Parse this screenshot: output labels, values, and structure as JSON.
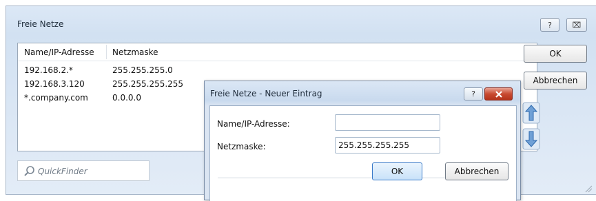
{
  "main_window": {
    "title": "Freie Netze",
    "help_glyph": "?",
    "close_glyph": "⌧"
  },
  "list": {
    "columns": [
      "Name/IP-Adresse",
      "Netzmaske"
    ],
    "rows": [
      {
        "name": "192.168.2.*",
        "mask": "255.255.255.0"
      },
      {
        "name": "192.168.3.120",
        "mask": "255.255.255.255"
      },
      {
        "name": "*.company.com",
        "mask": "0.0.0.0"
      }
    ]
  },
  "quickfinder": {
    "placeholder": "QuickFinder",
    "icon": "search-icon"
  },
  "buttons": {
    "ok": "OK",
    "cancel": "Abbrechen",
    "up_icon": "arrow-up-icon",
    "down_icon": "arrow-down-icon"
  },
  "sub_dialog": {
    "title": "Freie Netze - Neuer Eintrag",
    "help_glyph": "?",
    "name_label": "Name/IP-Adresse:",
    "name_value": "",
    "mask_label": "Netzmaske:",
    "mask_value": "255.255.255.255",
    "ok": "OK",
    "cancel": "Abbrechen"
  },
  "colors": {
    "accent": "#3a7ac8",
    "close_red": "#c84a30",
    "window_bg": "#d2e1f2"
  }
}
